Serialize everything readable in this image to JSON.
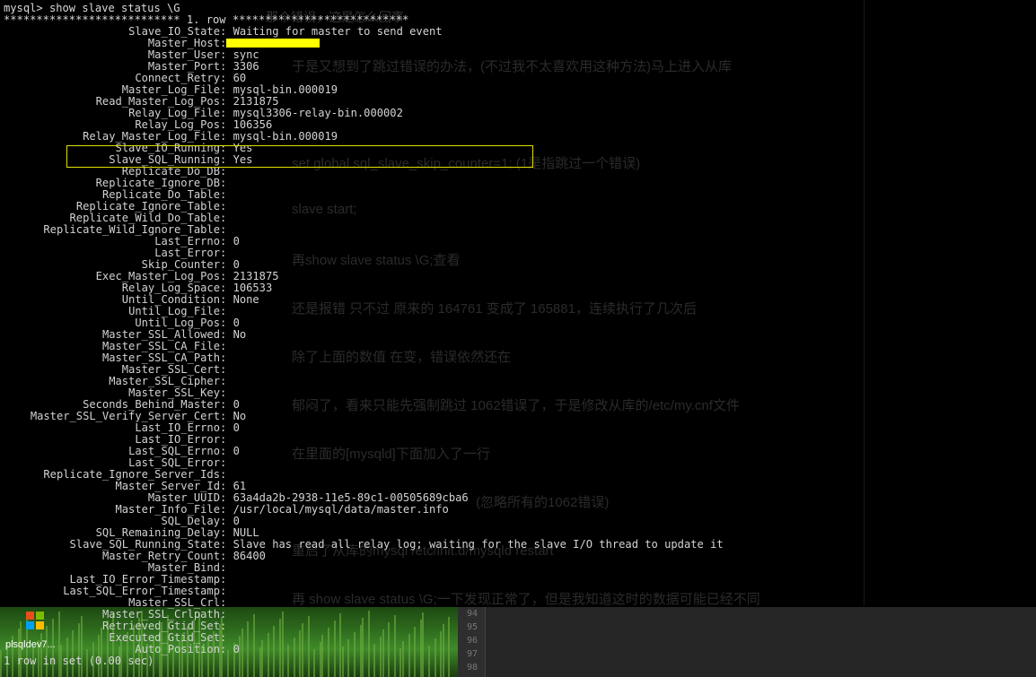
{
  "command": "mysql> show slave status \\G",
  "row_header": "*************************** 1. row ***************************",
  "fields": [
    {
      "name": "Slave_IO_State",
      "value": "Waiting for master to send event"
    },
    {
      "name": "Master_Host",
      "value": ""
    },
    {
      "name": "Master_User",
      "value": "sync"
    },
    {
      "name": "Master_Port",
      "value": "3306"
    },
    {
      "name": "Connect_Retry",
      "value": "60"
    },
    {
      "name": "Master_Log_File",
      "value": "mysql-bin.000019"
    },
    {
      "name": "Read_Master_Log_Pos",
      "value": "2131875"
    },
    {
      "name": "Relay_Log_File",
      "value": "mysql3306-relay-bin.000002"
    },
    {
      "name": "Relay_Log_Pos",
      "value": "106356"
    },
    {
      "name": "Relay_Master_Log_File",
      "value": "mysql-bin.000019"
    },
    {
      "name": "Slave_IO_Running",
      "value": "Yes"
    },
    {
      "name": "Slave_SQL_Running",
      "value": "Yes"
    },
    {
      "name": "Replicate_Do_DB",
      "value": ""
    },
    {
      "name": "Replicate_Ignore_DB",
      "value": ""
    },
    {
      "name": "Replicate_Do_Table",
      "value": ""
    },
    {
      "name": "Replicate_Ignore_Table",
      "value": ""
    },
    {
      "name": "Replicate_Wild_Do_Table",
      "value": ""
    },
    {
      "name": "Replicate_Wild_Ignore_Table",
      "value": ""
    },
    {
      "name": "Last_Errno",
      "value": "0"
    },
    {
      "name": "Last_Error",
      "value": ""
    },
    {
      "name": "Skip_Counter",
      "value": "0"
    },
    {
      "name": "Exec_Master_Log_Pos",
      "value": "2131875"
    },
    {
      "name": "Relay_Log_Space",
      "value": "106533"
    },
    {
      "name": "Until_Condition",
      "value": "None"
    },
    {
      "name": "Until_Log_File",
      "value": ""
    },
    {
      "name": "Until_Log_Pos",
      "value": "0"
    },
    {
      "name": "Master_SSL_Allowed",
      "value": "No"
    },
    {
      "name": "Master_SSL_CA_File",
      "value": ""
    },
    {
      "name": "Master_SSL_CA_Path",
      "value": ""
    },
    {
      "name": "Master_SSL_Cert",
      "value": ""
    },
    {
      "name": "Master_SSL_Cipher",
      "value": ""
    },
    {
      "name": "Master_SSL_Key",
      "value": ""
    },
    {
      "name": "Seconds_Behind_Master",
      "value": "0"
    },
    {
      "name": "Master_SSL_Verify_Server_Cert",
      "value": "No"
    },
    {
      "name": "Last_IO_Errno",
      "value": "0"
    },
    {
      "name": "Last_IO_Error",
      "value": ""
    },
    {
      "name": "Last_SQL_Errno",
      "value": "0"
    },
    {
      "name": "Last_SQL_Error",
      "value": ""
    },
    {
      "name": "Replicate_Ignore_Server_Ids",
      "value": ""
    },
    {
      "name": "Master_Server_Id",
      "value": "61"
    },
    {
      "name": "Master_UUID",
      "value": "63a4da2b-2938-11e5-89c1-00505689cba6"
    },
    {
      "name": "Master_Info_File",
      "value": "/usr/local/mysql/data/master.info"
    },
    {
      "name": "SQL_Delay",
      "value": "0"
    },
    {
      "name": "SQL_Remaining_Delay",
      "value": "NULL"
    },
    {
      "name": "Slave_SQL_Running_State",
      "value": "Slave has read all relay log; waiting for the slave I/O thread to update it"
    },
    {
      "name": "Master_Retry_Count",
      "value": "86400"
    },
    {
      "name": "Master_Bind",
      "value": ""
    },
    {
      "name": "Last_IO_Error_Timestamp",
      "value": ""
    },
    {
      "name": "Last_SQL_Error_Timestamp",
      "value": ""
    },
    {
      "name": "Master_SSL_Crl",
      "value": ""
    },
    {
      "name": "Master_SSL_Crlpath",
      "value": ""
    },
    {
      "name": "Retrieved_Gtid_Set",
      "value": ""
    },
    {
      "name": "Executed_Gtid_Set",
      "value": ""
    },
    {
      "name": "Auto_Position",
      "value": "0"
    }
  ],
  "footer": "1 row in set (0.00 sec)",
  "background_doc": {
    "top_fragment": "那个错误，这是怎么回事",
    "lines": [
      "于是又想到了跳过错误的办法，(不过我不太喜欢用这种方法)马上进入从库",
      "set global sql_slave_skip_counter=1; (1是指跳过一个错误)",
      "slave start;",
      "再show slave status \\G;查看",
      "还是报错 只不过 原来的 164761 变成了 165881，连续执行了几次后",
      "除了上面的数值 在变，错误依然还在",
      "郁闷了，看来只能先强制跳过 1062错误了，于是修改从库的/etc/my.cnf文件",
      "在里面的[mysqld]下面加入了一行",
      "(忽略所有的1062错误)",
      "重启了从库的mysql /etc/init.d/mysqld restart",
      "再 show slave status \\G;一下发现正常了，但是我知道这时的数据可能已经不同"
    ]
  },
  "desktop": {
    "icon_label": "plsqldev7...",
    "icon": "windows-logo-icon"
  },
  "editor_line_numbers": [
    "94",
    "95",
    "96",
    "97",
    "98"
  ],
  "colors": {
    "terminal_bg": "#000000",
    "highlight_box": "#e0e000",
    "redaction": "#ffff00"
  }
}
